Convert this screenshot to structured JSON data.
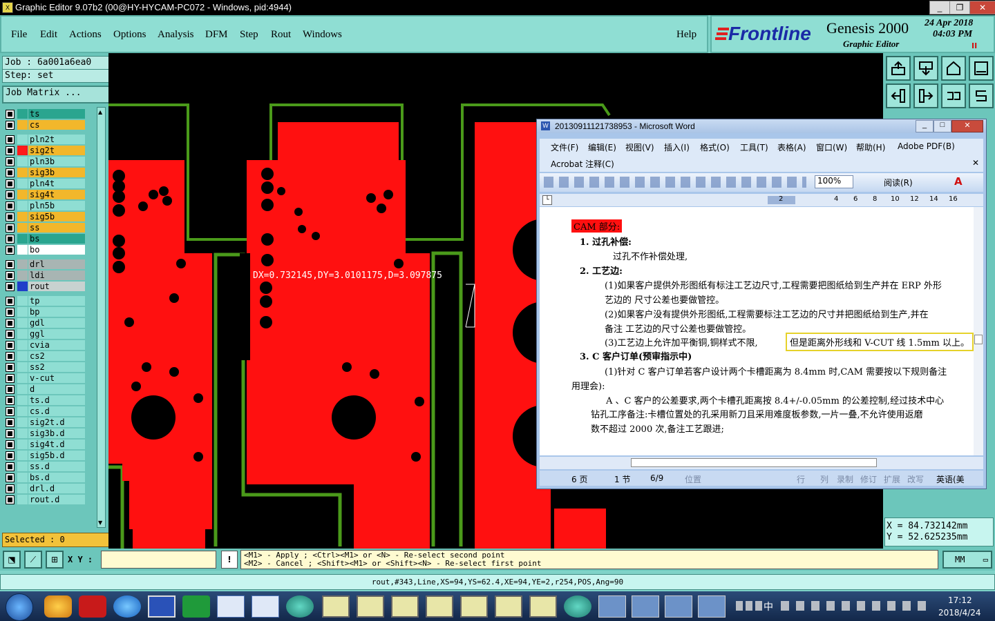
{
  "window": {
    "title": "Graphic Editor 9.07b2 (00@HY-HYCAM-PC072 - Windows, pid:4944)",
    "app_icon_glyph": "X",
    "controls": {
      "minimize": "_",
      "restore": "❐",
      "close": "✕"
    }
  },
  "menubar": {
    "items": [
      "File",
      "Edit",
      "Actions",
      "Options",
      "Analysis",
      "DFM",
      "Step",
      "Rout",
      "Windows"
    ],
    "help": "Help"
  },
  "brand": {
    "logo": "Frontline",
    "product": "Genesis 2000",
    "subtitle": "Graphic Editor",
    "date": "24 Apr 2018",
    "time": "04:03 PM",
    "pause_glyph": "II"
  },
  "job": {
    "job_label": "Job : 6a001a6ea0",
    "step_label": "Step: set",
    "matrix_button": "Job Matrix ..."
  },
  "layers": [
    {
      "name": "ts",
      "bg": "#2aa58f",
      "swatch": "#2aa58f"
    },
    {
      "name": "cs",
      "bg": "#f2b72b",
      "swatch": "#f2b72b"
    },
    {
      "name": "pln2t",
      "bg": "#8fded3",
      "swatch": "#8fded3"
    },
    {
      "name": "sig2t",
      "bg": "#f2b72b",
      "swatch": "#ff1a1a"
    },
    {
      "name": "pln3b",
      "bg": "#8fded3",
      "swatch": "#8fded3"
    },
    {
      "name": "sig3b",
      "bg": "#f2b72b",
      "swatch": "#f2b72b"
    },
    {
      "name": "pln4t",
      "bg": "#8fded3",
      "swatch": "#8fded3"
    },
    {
      "name": "sig4t",
      "bg": "#f2b72b",
      "swatch": "#f2b72b"
    },
    {
      "name": "pln5b",
      "bg": "#8fded3",
      "swatch": "#8fded3"
    },
    {
      "name": "sig5b",
      "bg": "#f2b72b",
      "swatch": "#f2b72b"
    },
    {
      "name": "ss",
      "bg": "#f2b72b",
      "swatch": "#f2b72b"
    },
    {
      "name": "bs",
      "bg": "#2aa58f",
      "swatch": "#2aa58f"
    },
    {
      "name": "bo",
      "bg": "#ffffff",
      "swatch": "#ffffff"
    },
    {
      "name": "drl",
      "bg": "#a8b5b3",
      "swatch": "#a8b5b3"
    },
    {
      "name": "ldi",
      "bg": "#a8b5b3",
      "swatch": "#a8b5b3"
    },
    {
      "name": "rout",
      "bg": "#c8d2d0",
      "swatch": "#1f3fc9"
    },
    {
      "name": "tp",
      "bg": "#8fded3",
      "swatch": "#8fded3"
    },
    {
      "name": "bp",
      "bg": "#8fded3",
      "swatch": "#8fded3"
    },
    {
      "name": "gdl",
      "bg": "#8fded3",
      "swatch": "#8fded3"
    },
    {
      "name": "ggl",
      "bg": "#8fded3",
      "swatch": "#8fded3"
    },
    {
      "name": "cvia",
      "bg": "#8fded3",
      "swatch": "#8fded3"
    },
    {
      "name": "cs2",
      "bg": "#8fded3",
      "swatch": "#8fded3"
    },
    {
      "name": "ss2",
      "bg": "#8fded3",
      "swatch": "#8fded3"
    },
    {
      "name": "v-cut",
      "bg": "#8fded3",
      "swatch": "#8fded3"
    },
    {
      "name": "d",
      "bg": "#8fded3",
      "swatch": "#8fded3"
    },
    {
      "name": "ts.d",
      "bg": "#8fded3",
      "swatch": "#8fded3"
    },
    {
      "name": "cs.d",
      "bg": "#8fded3",
      "swatch": "#8fded3"
    },
    {
      "name": "sig2t.d",
      "bg": "#8fded3",
      "swatch": "#8fded3"
    },
    {
      "name": "sig3b.d",
      "bg": "#8fded3",
      "swatch": "#8fded3"
    },
    {
      "name": "sig4t.d",
      "bg": "#8fded3",
      "swatch": "#8fded3"
    },
    {
      "name": "sig5b.d",
      "bg": "#8fded3",
      "swatch": "#8fded3"
    },
    {
      "name": "ss.d",
      "bg": "#8fded3",
      "swatch": "#8fded3"
    },
    {
      "name": "bs.d",
      "bg": "#8fded3",
      "swatch": "#8fded3"
    },
    {
      "name": "drl.d",
      "bg": "#8fded3",
      "swatch": "#8fded3"
    },
    {
      "name": "rout.d",
      "bg": "#8fded3",
      "swatch": "#8fded3"
    }
  ],
  "selected": "Selected : 0",
  "measure": "DX=0.732145,DY=3.0101175,D=3.097875",
  "coords": {
    "x": "X = 84.732142mm",
    "y": "Y = 52.625235mm"
  },
  "units": "MM",
  "cmd": {
    "xy_label": "X Y :",
    "input_value": "",
    "hint1": "<M1> - Apply  ; <Ctrl><M1> or <N> - Re-select second point",
    "hint2": "<M2> - Cancel ; <Shift><M1> or <Shift><N> - Re-select first point"
  },
  "status": "rout,#343,Line,XS=94,YS=62.4,XE=94,YE=2,r254,POS,Ang=90",
  "word": {
    "title": "20130911121738953 - Microsoft Word",
    "menus": [
      "文件(F)",
      "编辑(E)",
      "视图(V)",
      "插入(I)",
      "格式(O)",
      "工具(T)",
      "表格(A)",
      "窗口(W)",
      "帮助(H)",
      "Adobe PDF(B)"
    ],
    "menu2": "Acrobat 注释(C)",
    "zoom": "100%",
    "read_button": "阅读(R)",
    "ruler_ticks": [
      "2",
      "2",
      "4",
      "6",
      "8",
      "10",
      "12",
      "14",
      "16"
    ],
    "doc_lines": [
      "CAM 部分:",
      "1.  过孔补偿:",
      "过孔不作补偿处理,",
      "2.  工艺边:",
      "(1)如果客户提供外形图纸有标注工艺边尺寸,工程需要把图纸给到生产并在 ERP 外形",
      "艺边的 尺寸公差也要做管控。",
      "(2)如果客户没有提供外形图纸,工程需要标注工艺边的尺寸并把图纸给到生产,并在",
      "备注  工艺边的尺寸公差也要做管控。",
      "(3)工艺边上允许加平衡铜,铜样式不限,",
      "但是距离外形线和 V-CUT 线 1.5mm 以上。",
      "3.  C 客户订单(预审指示中)",
      "(1)针对 C 客户订单若客户设计两个卡槽距离为 8.4mm 时,CAM 需要按以下规则备注",
      "用理会):",
      "A 、C 客户的公差要求,两个卡槽孔距离按 8.4+/-0.05mm 的公差控制,经过技术中心",
      "钻孔工序备注:卡槽位置处的孔采用新刀且采用难度板参数,一片一叠,不允许使用返磨",
      "数不超过 2000 次,备注工艺跟进;"
    ],
    "status_items": [
      "6 页",
      "1 节",
      "6/9",
      "位置",
      "行",
      "列",
      "录制",
      "修订",
      "扩展",
      "改写",
      "英语(美"
    ]
  },
  "taskbar": {
    "time": "17:12",
    "date": "2018/4/24",
    "tray_text": "中"
  },
  "colors": {
    "copper": "#ff1010",
    "outline": "#4a9a1a",
    "panel": "#8fded3"
  }
}
